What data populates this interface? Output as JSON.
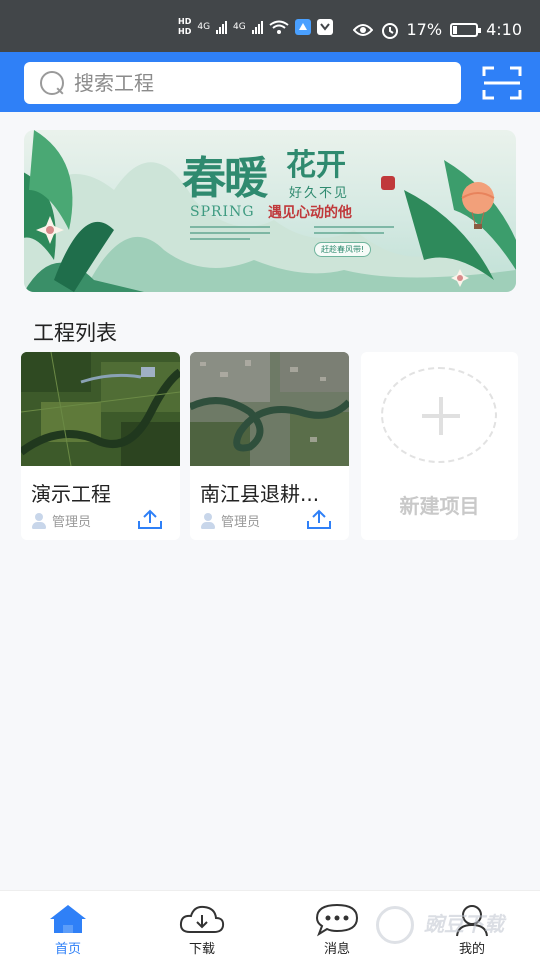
{
  "status_bar": {
    "hd1": "HD",
    "hd2": "HD",
    "net1": "4G",
    "net2": "4G",
    "battery_pct": "17%",
    "battery_level": 0.17,
    "time": "4:10"
  },
  "header": {
    "search_placeholder": "搜索工程",
    "scan_icon": "scan-icon",
    "bg_color": "#2f80f7"
  },
  "banner": {
    "title_main": "春暖",
    "title_sub": "花开",
    "tagline": "好久不见",
    "spring_en": "SPRING",
    "spring_cn": "遇见心动的他",
    "button_text": "赶趁春风带!"
  },
  "section": {
    "title": "工程列表"
  },
  "projects": [
    {
      "name": "演示工程",
      "user": "管理员",
      "user_icon": "user-icon",
      "action_icon": "upload-icon"
    },
    {
      "name": "南江县退耕...",
      "user": "管理员",
      "user_icon": "user-icon",
      "action_icon": "upload-icon"
    }
  ],
  "new_project": {
    "label": "新建项目",
    "icon": "plus-icon"
  },
  "tabs": [
    {
      "label": "首页",
      "icon": "home-icon",
      "active": true
    },
    {
      "label": "下载",
      "icon": "cloud-download-icon",
      "active": false
    },
    {
      "label": "消息",
      "icon": "message-icon",
      "active": false
    },
    {
      "label": "我的",
      "icon": "profile-icon",
      "active": false
    }
  ],
  "watermark": "豌豆下载",
  "colors": {
    "accent": "#2f80f7",
    "status_bar": "#424649",
    "banner_green": "#2f8a6f"
  }
}
